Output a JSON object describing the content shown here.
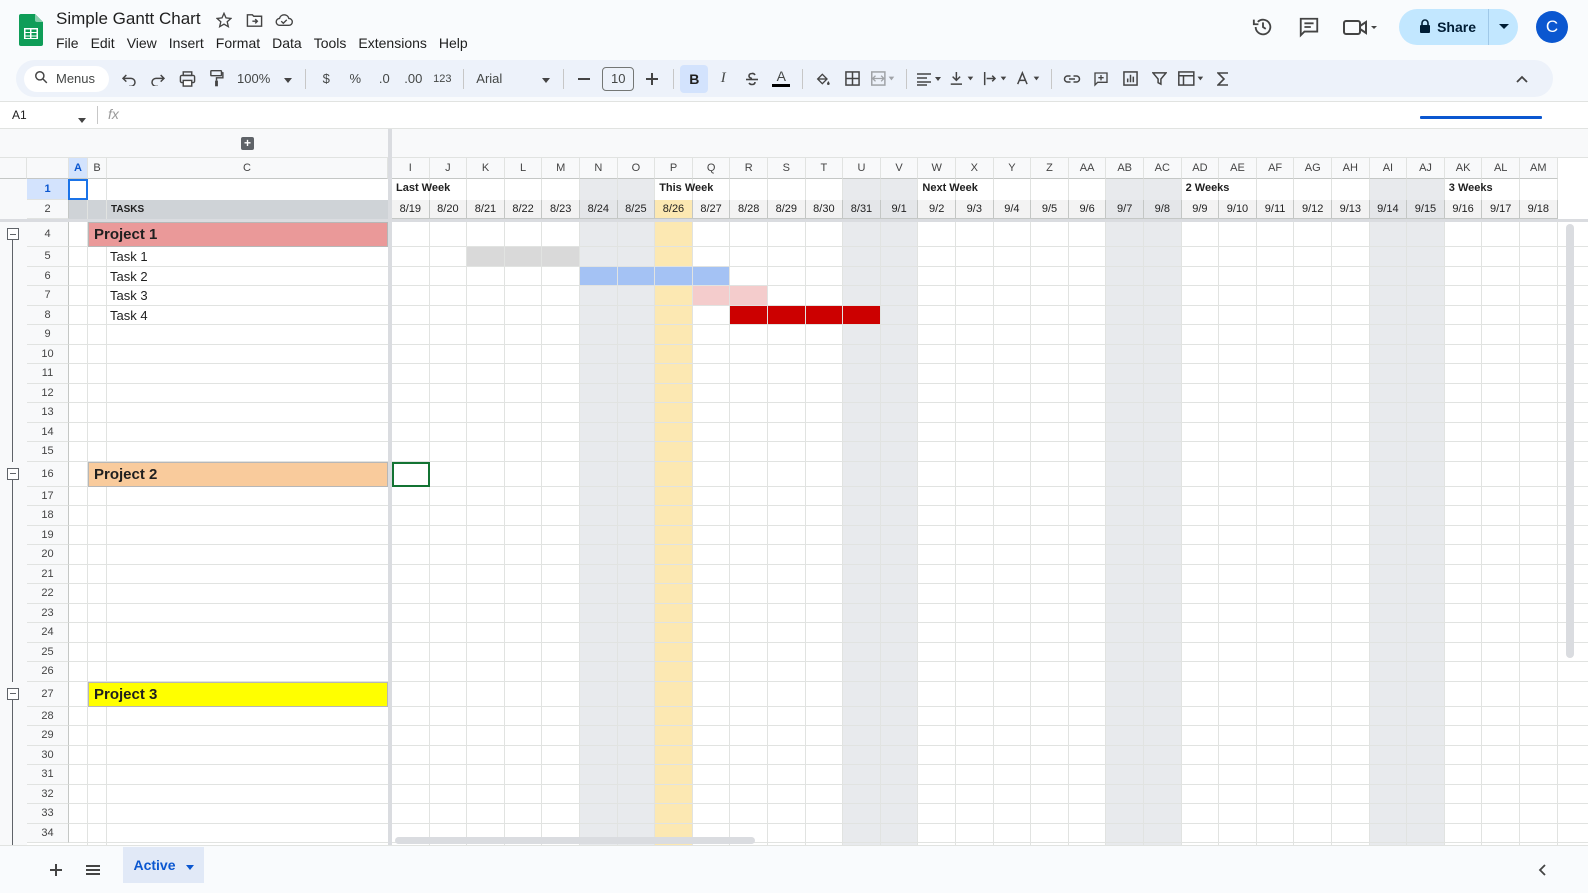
{
  "doc": {
    "title": "Simple Gantt Chart"
  },
  "menu": [
    "File",
    "Edit",
    "View",
    "Insert",
    "Format",
    "Data",
    "Tools",
    "Extensions",
    "Help"
  ],
  "share": {
    "label": "Share"
  },
  "avatar": {
    "initial": "C"
  },
  "toolbar": {
    "search_label": "Menus",
    "zoom": "100%",
    "currency": "$",
    "percent": "%",
    "decrease_decimal": ".0",
    "increase_decimal": ".00",
    "number_format": "123",
    "font": "Arial",
    "font_size": "10",
    "bold": "B",
    "italic": "I",
    "text_color": "A"
  },
  "namebox": {
    "value": "A1"
  },
  "formula": {
    "fx": "fx"
  },
  "colors": {
    "project1": "#ea9999",
    "project2": "#f9cb9c",
    "project3": "#ffff00",
    "today": "#fce8b2",
    "weekend": "#e8eaed",
    "task1": "#d9d9d9",
    "task2": "#a4c2f4",
    "task3": "#f4cccc",
    "task4": "#cc0000"
  },
  "frozen_columns": [
    "A",
    "B",
    "C"
  ],
  "columns": [
    "I",
    "J",
    "K",
    "L",
    "M",
    "N",
    "O",
    "P",
    "Q",
    "R",
    "S",
    "T",
    "U",
    "V",
    "W",
    "X",
    "Y",
    "Z",
    "AA",
    "AB",
    "AC",
    "AD",
    "AE",
    "AF",
    "AG",
    "AH",
    "AI",
    "AJ",
    "AK",
    "AL",
    "AM"
  ],
  "dates": [
    "8/19",
    "8/20",
    "8/21",
    "8/22",
    "8/23",
    "8/24",
    "8/25",
    "8/26",
    "8/27",
    "8/28",
    "8/29",
    "8/30",
    "8/31",
    "9/1",
    "9/2",
    "9/3",
    "9/4",
    "9/5",
    "9/6",
    "9/7",
    "9/8",
    "9/9",
    "9/10",
    "9/11",
    "9/12",
    "9/13",
    "9/14",
    "9/15",
    "9/16",
    "9/17",
    "9/18"
  ],
  "weekend_cols": [
    5,
    6,
    12,
    13,
    19,
    20,
    26,
    27
  ],
  "today_col": 7,
  "weeks": [
    {
      "label": "Last Week",
      "col": 0
    },
    {
      "label": "This Week",
      "col": 7
    },
    {
      "label": "Next Week",
      "col": 14
    },
    {
      "label": "2 Weeks",
      "col": 21
    },
    {
      "label": "3 Weeks",
      "col": 28
    }
  ],
  "tasks_header": "TASKS",
  "rows": [
    "1",
    "2",
    "4",
    "5",
    "6",
    "7",
    "8",
    "9",
    "10",
    "11",
    "12",
    "13",
    "14",
    "15",
    "16",
    "17",
    "18",
    "19",
    "20",
    "21",
    "22",
    "23",
    "24",
    "25",
    "26",
    "27",
    "28",
    "29",
    "30",
    "31",
    "32",
    "33",
    "34"
  ],
  "projects": [
    {
      "name": "Project 1",
      "row": "4",
      "color_key": "project1"
    },
    {
      "name": "Project 2",
      "row": "16",
      "color_key": "project2"
    },
    {
      "name": "Project 3",
      "row": "27",
      "color_key": "project3"
    }
  ],
  "tasks": [
    {
      "name": "Task 1",
      "row": "5",
      "start": 2,
      "span": 3,
      "color_key": "task1"
    },
    {
      "name": "Task 2",
      "row": "6",
      "start": 5,
      "span": 4,
      "color_key": "task2"
    },
    {
      "name": "Task 3",
      "row": "7",
      "start": 8,
      "span": 2,
      "color_key": "task3"
    },
    {
      "name": "Task 4",
      "row": "8",
      "start": 9,
      "span": 4,
      "color_key": "task4"
    }
  ],
  "selected_cell": {
    "row": "16",
    "col": 0
  },
  "sheet_tab": {
    "label": "Active"
  }
}
